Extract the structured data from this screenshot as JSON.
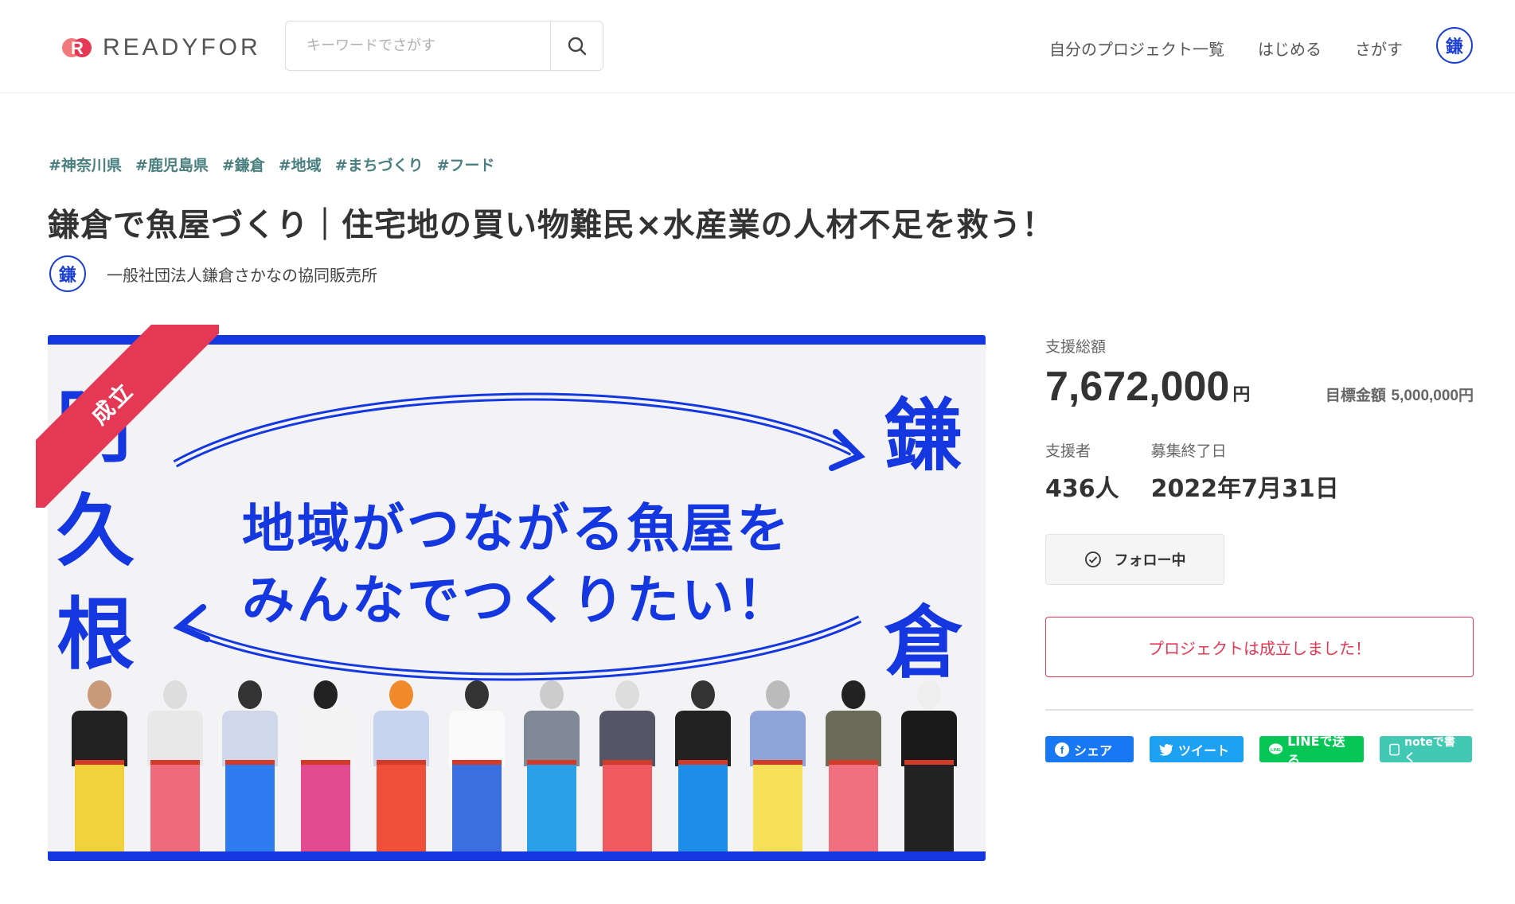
{
  "header": {
    "logo_text": "READYFOR",
    "search_placeholder": "キーワードでさがす",
    "nav": [
      "自分のプロジェクト一覧",
      "はじめる",
      "さがす"
    ],
    "avatar_glyph": "鎌"
  },
  "project": {
    "tags": [
      "#神奈川県",
      "#鹿児島県",
      "#鎌倉",
      "#地域",
      "#まちづくり",
      "#フード"
    ],
    "title": "鎌倉で魚屋づくり｜住宅地の買い物難民×水産業の人材不足を救う！",
    "owner_name": "一般社団法人鎌倉さかなの協同販売所",
    "owner_avatar_glyph": "鎌"
  },
  "hero": {
    "ribbon_label": "成立",
    "left_vertical": [
      "阿",
      "久",
      "根"
    ],
    "right_vertical": [
      "鎌",
      "倉"
    ],
    "headline_line1": "地域がつながる魚屋を",
    "headline_line2": "みんなでつくりたい！"
  },
  "side": {
    "total_label": "支援総額",
    "total_value": "7,672,000",
    "total_unit": "円",
    "goal_label": "目標金額",
    "goal_value": "5,000,000円",
    "supporters_label": "支援者",
    "supporters_value": "436人",
    "end_label": "募集終了日",
    "end_value": "2022年7月31日",
    "follow_label": "フォロー中",
    "success_message": "プロジェクトは成立しました！",
    "share": {
      "facebook": "シェア",
      "twitter": "ツイート",
      "line": "LINEで送る",
      "note": "noteで書く"
    }
  },
  "colors": {
    "brand_red": "#e43854",
    "hero_blue": "#1437e0",
    "tag_teal": "#4a7f80"
  }
}
